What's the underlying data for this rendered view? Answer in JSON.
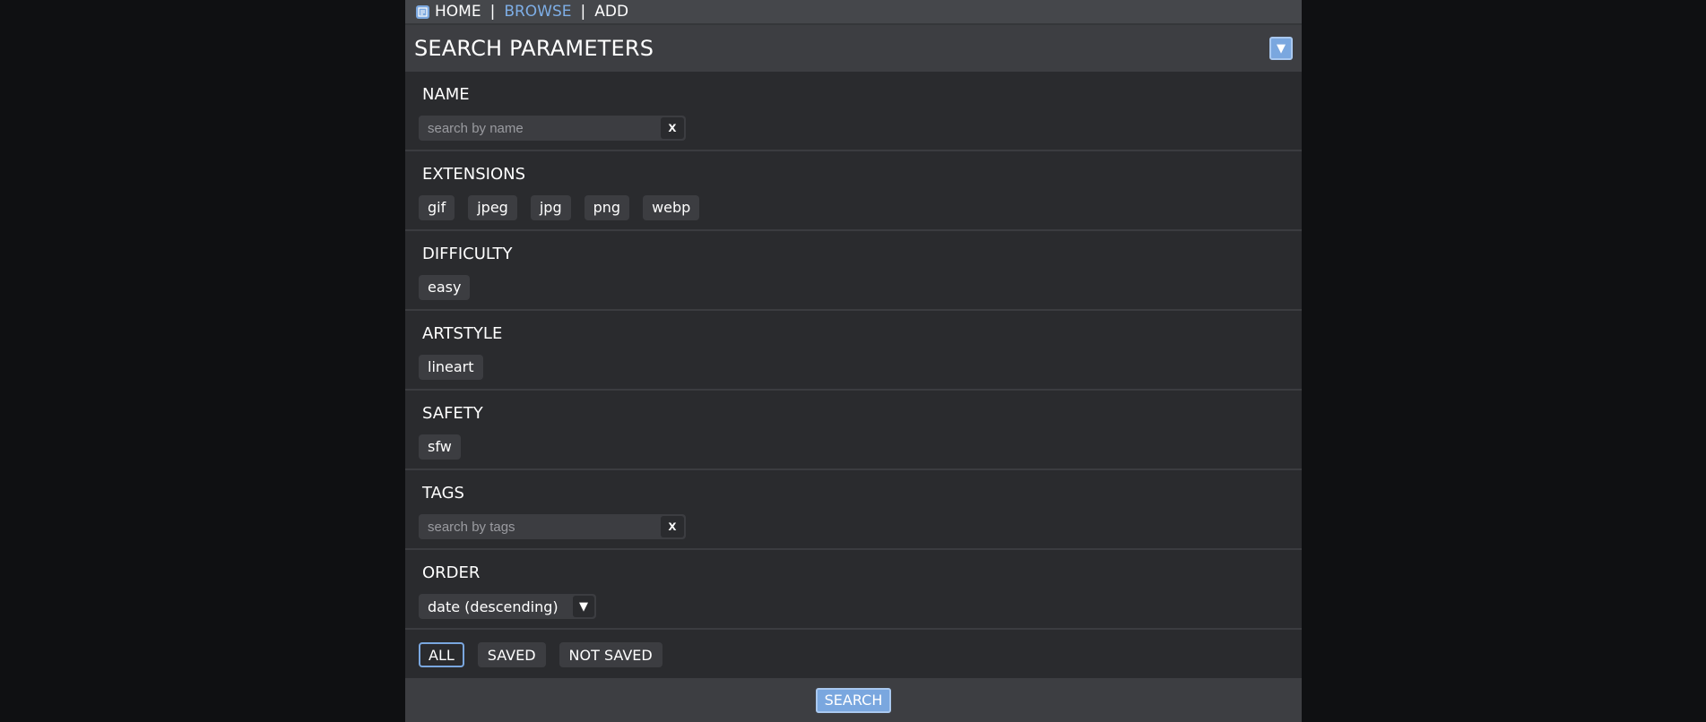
{
  "nav": {
    "home": "HOME",
    "browse": "BROWSE",
    "add": "ADD",
    "separator": "|"
  },
  "header": {
    "title": "SEARCH PARAMETERS",
    "collapse_glyph": "▼"
  },
  "sections": {
    "name": {
      "label": "NAME",
      "placeholder": "search by name",
      "clear": "x"
    },
    "extensions": {
      "label": "EXTENSIONS",
      "chips": [
        "gif",
        "jpeg",
        "jpg",
        "png",
        "webp"
      ]
    },
    "difficulty": {
      "label": "DIFFICULTY",
      "chips": [
        "easy"
      ]
    },
    "artstyle": {
      "label": "ARTSTYLE",
      "chips": [
        "lineart"
      ]
    },
    "safety": {
      "label": "SAFETY",
      "chips": [
        "sfw"
      ]
    },
    "tags": {
      "label": "TAGS",
      "placeholder": "search by tags",
      "clear": "x"
    },
    "order": {
      "label": "ORDER",
      "selected": "date (descending)",
      "arrow": "▼"
    }
  },
  "filters": {
    "all": "ALL",
    "saved": "SAVED",
    "not_saved": "NOT SAVED",
    "active": "ALL"
  },
  "footer": {
    "search": "SEARCH"
  },
  "colors": {
    "accent": "#7aa7df",
    "background": "#2a2b2e",
    "page_bg": "#0f1012",
    "chip_bg": "#3c3d41"
  },
  "icons": {
    "nav_logo": "music-note-icon"
  }
}
